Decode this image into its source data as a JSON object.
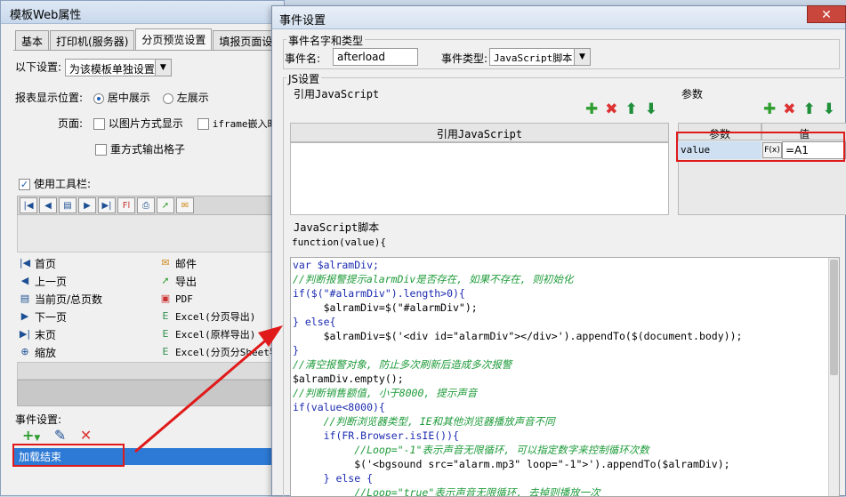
{
  "back_window": {
    "title": "模板Web属性",
    "tabs": [
      "基本",
      "打印机(服务器)",
      "分页预览设置",
      "填报页面设"
    ],
    "settings_label": "以下设置:",
    "settings_value": "为该模板单独设置",
    "position_label": "报表显示位置:",
    "position_options": [
      "居中展示",
      "左展示"
    ],
    "page_label": "页面:",
    "page_checks": [
      "以图片方式显示",
      "iframe嵌入时",
      "重方式输出格子"
    ],
    "use_toolbar_label": "使用工具栏:",
    "toolbar_icons": [
      "first-page-icon",
      "prev-page-icon",
      "page-count-icon",
      "next-page-icon",
      "last-page-icon",
      "flash-print-icon",
      "print-icon",
      "export-icon",
      "email-icon"
    ],
    "items_left": [
      "首页",
      "上一页",
      "当前页/总页数",
      "下一页",
      "末页",
      "缩放"
    ],
    "items_right": [
      "邮件",
      "导出",
      "PDF",
      "Excel(分页导出)",
      "Excel(原样导出)",
      "Excel(分页分Sheet导"
    ],
    "event_label": "事件设置:",
    "event_item": "加载结束"
  },
  "dialog": {
    "title": "事件设置",
    "group_name_type": "事件名字和类型",
    "event_name_label": "事件名:",
    "event_name_value": "afterload",
    "event_type_label": "事件类型:",
    "event_type_value": "JavaScript脚本",
    "js_settings": "JS设置",
    "ref_js_group": "引用JavaScript",
    "ref_js_header": "引用JavaScript",
    "params_group": "参数",
    "param_col": "参数",
    "value_col": "值",
    "param_name": "value",
    "fx_label": "F(x)",
    "param_value": "=A1",
    "script_group": "JavaScript脚本",
    "function_sig": "function(value){",
    "code_lines": [
      "var $alramDiv;",
      "//判断报警提示alarmDiv是否存在, 如果不存在, 则初始化",
      "if($(\"#alarmDiv\").length>0){",
      "     $alramDiv=$(\"#alarmDiv\");",
      "} else{",
      "     $alramDiv=$('<div id=\"alarmDiv\"></div>').appendTo($(document.body));",
      "}",
      "//清空报警对象, 防止多次刷新后造成多次报警",
      "$alramDiv.empty();",
      "//判断销售额值, 小于8000, 提示声音",
      "if(value<8000){",
      "     //判断浏览器类型, IE和其他浏览器播放声音不同",
      "     if(FR.Browser.isIE()){",
      "          //Loop=\"-1\"表示声音无限循环, 可以指定数字来控制循环次数",
      "          $('<bgsound src=\"alarm.mp3\" loop=\"-1\">').appendTo($alramDiv);",
      "     } else {",
      "          //Loop=\"true\"表示声音无限循环, 去掉则播放一次"
    ]
  },
  "colors": {
    "accent": "#2d7ad6",
    "annotation": "#e01a1a",
    "add": "#2f9e2f",
    "delete": "#dd3333"
  }
}
